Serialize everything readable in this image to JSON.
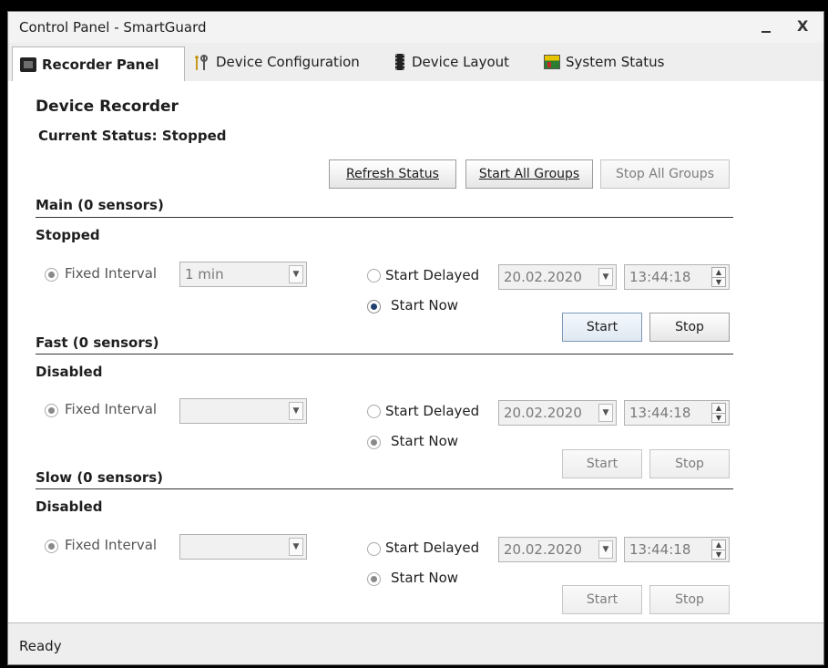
{
  "window": {
    "title": "Control Panel - SmartGuard",
    "close_label": "X"
  },
  "tabs": [
    {
      "label": "Recorder Panel",
      "icon": "recorder-icon",
      "active": true
    },
    {
      "label": "Device Configuration",
      "icon": "tools-icon",
      "active": false
    },
    {
      "label": "Device Layout",
      "icon": "chip-icon",
      "active": false
    },
    {
      "label": "System Status",
      "icon": "status-chart-icon",
      "active": false
    }
  ],
  "recorder": {
    "heading": "Device Recorder",
    "current_status": "Current Status:  Stopped",
    "buttons": {
      "refresh": "Refresh Status",
      "start_all": "Start All Groups",
      "stop_all": "Stop All Groups"
    }
  },
  "groups": [
    {
      "title": "Main (0 sensors)",
      "state": "Stopped",
      "fixed_interval_label": "Fixed Interval",
      "interval_value": "1 min",
      "start_delayed_label": "Start Delayed",
      "date": "20.02.2020",
      "time": "13:44:18",
      "start_now_label": "Start Now",
      "start_label": "Start",
      "stop_label": "Stop"
    },
    {
      "title": "Fast (0 sensors)",
      "state": "Disabled",
      "fixed_interval_label": "Fixed Interval",
      "interval_value": "",
      "start_delayed_label": "Start Delayed",
      "date": "20.02.2020",
      "time": "13:44:18",
      "start_now_label": "Start Now",
      "start_label": "Start",
      "stop_label": "Stop"
    },
    {
      "title": "Slow (0 sensors)",
      "state": "Disabled",
      "fixed_interval_label": "Fixed Interval",
      "interval_value": "",
      "start_delayed_label": "Start Delayed",
      "date": "20.02.2020",
      "time": "13:44:18",
      "start_now_label": "Start Now",
      "start_label": "Start",
      "stop_label": "Stop"
    }
  ],
  "status_bar": {
    "text": "Ready"
  }
}
